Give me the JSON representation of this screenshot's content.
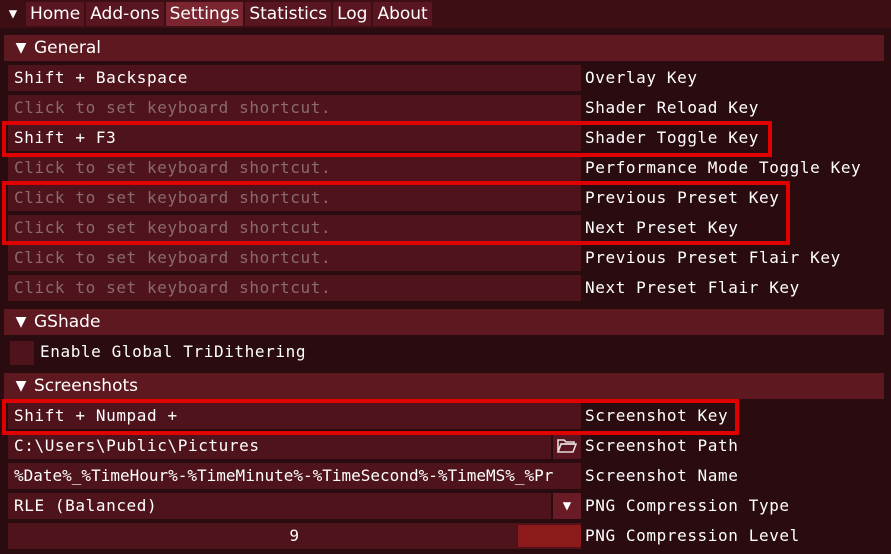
{
  "menu": {
    "items": [
      "Home",
      "Add-ons",
      "Settings",
      "Statistics",
      "Log",
      "About"
    ]
  },
  "general": {
    "title": "General",
    "rows": [
      {
        "value": "Shift + Backspace",
        "label": "Overlay Key",
        "placeholder": false
      },
      {
        "value": "Click to set keyboard shortcut.",
        "label": "Shader Reload Key",
        "placeholder": true
      },
      {
        "value": "Shift + F3",
        "label": "Shader Toggle Key",
        "placeholder": false
      },
      {
        "value": "Click to set keyboard shortcut.",
        "label": "Performance Mode Toggle Key",
        "placeholder": true
      },
      {
        "value": "Click to set keyboard shortcut.",
        "label": "Previous Preset Key",
        "placeholder": true
      },
      {
        "value": "Click to set keyboard shortcut.",
        "label": "Next Preset Key",
        "placeholder": true
      },
      {
        "value": "Click to set keyboard shortcut.",
        "label": "Previous Preset Flair Key",
        "placeholder": true
      },
      {
        "value": "Click to set keyboard shortcut.",
        "label": "Next Preset Flair Key",
        "placeholder": true
      }
    ]
  },
  "gshade": {
    "title": "GShade",
    "tridithering_label": "Enable Global TriDithering",
    "tridithering_checked": false
  },
  "screenshots": {
    "title": "Screenshots",
    "key_value": "Shift + Numpad +",
    "key_label": "Screenshot Key",
    "path_value": "C:\\Users\\Public\\Pictures",
    "path_label": "Screenshot Path",
    "name_value": "%Date%_%TimeHour%-%TimeMinute%-%TimeSecond%-%TimeMS%_%Pr",
    "name_label": "Screenshot Name",
    "compression_type_value": "RLE (Balanced)",
    "compression_type_label": "PNG Compression Type",
    "compression_level_value": "9",
    "compression_level_label": "PNG Compression Level"
  },
  "icons": {
    "menu_toggle": "triangle-down-icon",
    "section_toggle": "triangle-down-icon",
    "folder": "folder-open-icon",
    "dropdown": "triangle-down-icon"
  },
  "colors": {
    "background": "#2a0c10",
    "header": "#5e1820",
    "field": "#4f141b",
    "highlight": "#e00000",
    "slider": "#8c1a1a"
  }
}
